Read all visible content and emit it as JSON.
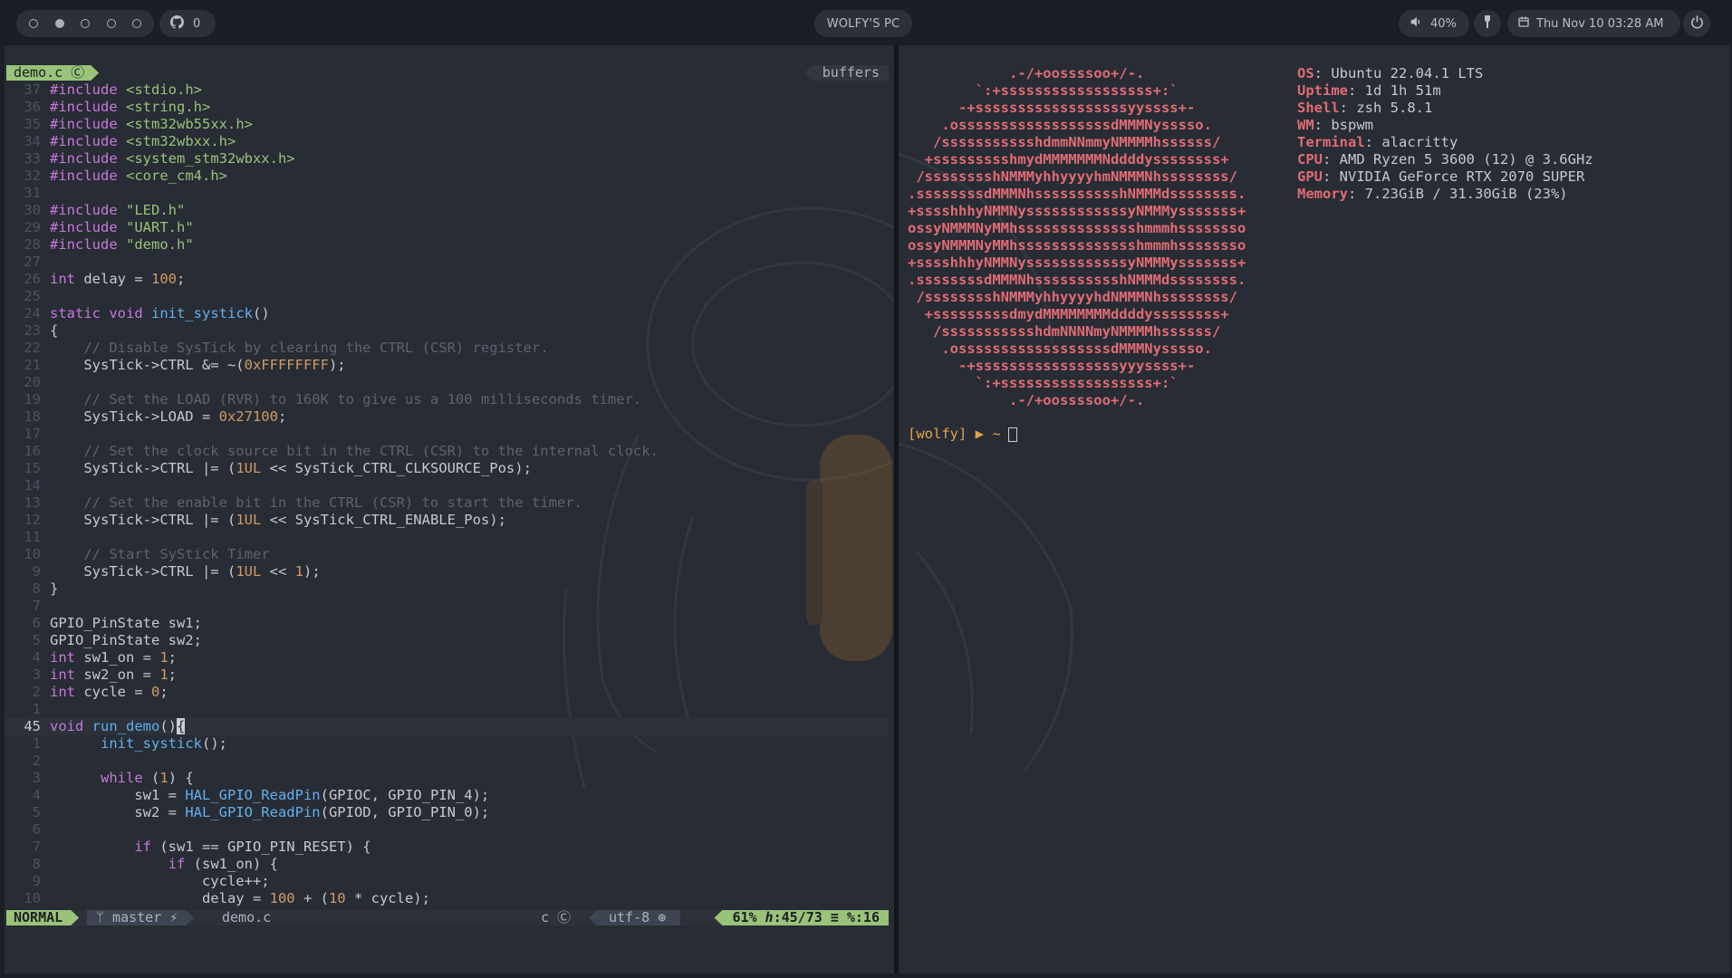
{
  "topbar": {
    "github_count": "0",
    "title": "WOLFY'S PC",
    "volume": "40%",
    "datetime": "Thu Nov 10 03:28 AM",
    "workspaces": [
      {
        "active": false
      },
      {
        "active": true
      },
      {
        "active": false
      },
      {
        "active": false
      },
      {
        "active": false
      }
    ]
  },
  "editor": {
    "tab_file": "demo.c",
    "tab_buffers": "buffers",
    "lines": [
      {
        "n": "37",
        "tokens": [
          [
            "kw",
            "#include"
          ],
          [
            "tx",
            " "
          ],
          [
            "str",
            "<stdio.h>"
          ]
        ]
      },
      {
        "n": "36",
        "tokens": [
          [
            "kw",
            "#include"
          ],
          [
            "tx",
            " "
          ],
          [
            "str",
            "<string.h>"
          ]
        ]
      },
      {
        "n": "35",
        "tokens": [
          [
            "kw",
            "#include"
          ],
          [
            "tx",
            " "
          ],
          [
            "str",
            "<stm32wb55xx.h>"
          ]
        ]
      },
      {
        "n": "34",
        "tokens": [
          [
            "kw",
            "#include"
          ],
          [
            "tx",
            " "
          ],
          [
            "str",
            "<stm32wbxx.h>"
          ]
        ]
      },
      {
        "n": "33",
        "tokens": [
          [
            "kw",
            "#include"
          ],
          [
            "tx",
            " "
          ],
          [
            "str",
            "<system_stm32wbxx.h>"
          ]
        ]
      },
      {
        "n": "32",
        "tokens": [
          [
            "kw",
            "#include"
          ],
          [
            "tx",
            " "
          ],
          [
            "str",
            "<core_cm4.h>"
          ]
        ]
      },
      {
        "n": "31",
        "tokens": []
      },
      {
        "n": "30",
        "tokens": [
          [
            "kw",
            "#include"
          ],
          [
            "tx",
            " "
          ],
          [
            "str",
            "\"LED.h\""
          ]
        ]
      },
      {
        "n": "29",
        "tokens": [
          [
            "kw",
            "#include"
          ],
          [
            "tx",
            " "
          ],
          [
            "str",
            "\"UART.h\""
          ]
        ]
      },
      {
        "n": "28",
        "tokens": [
          [
            "kw",
            "#include"
          ],
          [
            "tx",
            " "
          ],
          [
            "str",
            "\"demo.h\""
          ]
        ]
      },
      {
        "n": "27",
        "tokens": []
      },
      {
        "n": "26",
        "tokens": [
          [
            "kw",
            "int"
          ],
          [
            "tx",
            " delay = "
          ],
          [
            "num",
            "100"
          ],
          [
            "tx",
            ";"
          ]
        ]
      },
      {
        "n": "25",
        "tokens": []
      },
      {
        "n": "24",
        "tokens": [
          [
            "kw",
            "static"
          ],
          [
            "tx",
            " "
          ],
          [
            "kw",
            "void"
          ],
          [
            "tx",
            " "
          ],
          [
            "fn",
            "init_systick"
          ],
          [
            "tx",
            "()"
          ]
        ]
      },
      {
        "n": "23",
        "tokens": [
          [
            "tx",
            "{"
          ]
        ]
      },
      {
        "n": "22",
        "tokens": [
          [
            "tx",
            "    "
          ],
          [
            "cm",
            "// Disable SysTick by clearing the CTRL (CSR) register."
          ]
        ]
      },
      {
        "n": "21",
        "tokens": [
          [
            "tx",
            "    SysTick->CTRL &= ~("
          ],
          [
            "num",
            "0xFFFFFFFF"
          ],
          [
            "tx",
            ");"
          ]
        ]
      },
      {
        "n": "20",
        "tokens": []
      },
      {
        "n": "19",
        "tokens": [
          [
            "tx",
            "    "
          ],
          [
            "cm",
            "// Set the LOAD (RVR) to 160K to give us a 100 milliseconds timer."
          ]
        ]
      },
      {
        "n": "18",
        "tokens": [
          [
            "tx",
            "    SysTick->LOAD = "
          ],
          [
            "num",
            "0x27100"
          ],
          [
            "tx",
            ";"
          ]
        ]
      },
      {
        "n": "17",
        "tokens": []
      },
      {
        "n": "16",
        "tokens": [
          [
            "tx",
            "    "
          ],
          [
            "cm",
            "// Set the clock source bit in the CTRL (CSR) to the internal clock."
          ]
        ]
      },
      {
        "n": "15",
        "tokens": [
          [
            "tx",
            "    SysTick->CTRL |= ("
          ],
          [
            "num",
            "1UL"
          ],
          [
            "tx",
            " << SysTick_CTRL_CLKSOURCE_Pos);"
          ]
        ]
      },
      {
        "n": "14",
        "tokens": []
      },
      {
        "n": "13",
        "tokens": [
          [
            "tx",
            "    "
          ],
          [
            "cm",
            "// Set the enable bit in the CTRL (CSR) to start the timer."
          ]
        ]
      },
      {
        "n": "12",
        "tokens": [
          [
            "tx",
            "    SysTick->CTRL |= ("
          ],
          [
            "num",
            "1UL"
          ],
          [
            "tx",
            " << SysTick_CTRL_ENABLE_Pos);"
          ]
        ]
      },
      {
        "n": "11",
        "tokens": []
      },
      {
        "n": "10",
        "tokens": [
          [
            "tx",
            "    "
          ],
          [
            "cm",
            "// Start SyStick Timer"
          ]
        ]
      },
      {
        "n": "9",
        "tokens": [
          [
            "tx",
            "    SysTick->CTRL |= ("
          ],
          [
            "num",
            "1UL"
          ],
          [
            "tx",
            " << "
          ],
          [
            "num",
            "1"
          ],
          [
            "tx",
            ");"
          ]
        ]
      },
      {
        "n": "8",
        "tokens": [
          [
            "tx",
            "}"
          ]
        ]
      },
      {
        "n": "7",
        "tokens": []
      },
      {
        "n": "6",
        "tokens": [
          [
            "tx",
            "GPIO_PinState sw1;"
          ]
        ]
      },
      {
        "n": "5",
        "tokens": [
          [
            "tx",
            "GPIO_PinState sw2;"
          ]
        ]
      },
      {
        "n": "4",
        "tokens": [
          [
            "kw",
            "int"
          ],
          [
            "tx",
            " sw1_on = "
          ],
          [
            "num",
            "1"
          ],
          [
            "tx",
            ";"
          ]
        ]
      },
      {
        "n": "3",
        "tokens": [
          [
            "kw",
            "int"
          ],
          [
            "tx",
            " sw2_on = "
          ],
          [
            "num",
            "1"
          ],
          [
            "tx",
            ";"
          ]
        ]
      },
      {
        "n": "2",
        "tokens": [
          [
            "kw",
            "int"
          ],
          [
            "tx",
            " cycle = "
          ],
          [
            "num",
            "0"
          ],
          [
            "tx",
            ";"
          ]
        ]
      },
      {
        "n": "1",
        "tokens": []
      },
      {
        "n": "45",
        "current": true,
        "tokens": [
          [
            "kw",
            "void"
          ],
          [
            "tx",
            " "
          ],
          [
            "fn",
            "run_demo"
          ],
          [
            "tx",
            "()"
          ],
          [
            "cur",
            "{"
          ]
        ]
      },
      {
        "n": "1",
        "tokens": [
          [
            "tx",
            "      "
          ],
          [
            "fn",
            "init_systick"
          ],
          [
            "tx",
            "();"
          ]
        ]
      },
      {
        "n": "2",
        "tokens": []
      },
      {
        "n": "3",
        "tokens": [
          [
            "tx",
            "      "
          ],
          [
            "kw",
            "while"
          ],
          [
            "tx",
            " ("
          ],
          [
            "num",
            "1"
          ],
          [
            "tx",
            ") {"
          ]
        ]
      },
      {
        "n": "4",
        "tokens": [
          [
            "tx",
            "          sw1 = "
          ],
          [
            "fn",
            "HAL_GPIO_ReadPin"
          ],
          [
            "tx",
            "(GPIOC, GPIO_PIN_4);"
          ]
        ]
      },
      {
        "n": "5",
        "tokens": [
          [
            "tx",
            "          sw2 = "
          ],
          [
            "fn",
            "HAL_GPIO_ReadPin"
          ],
          [
            "tx",
            "(GPIOD, GPIO_PIN_0);"
          ]
        ]
      },
      {
        "n": "6",
        "tokens": []
      },
      {
        "n": "7",
        "tokens": [
          [
            "tx",
            "          "
          ],
          [
            "kw",
            "if"
          ],
          [
            "tx",
            " (sw1 == GPIO_PIN_RESET) {"
          ]
        ]
      },
      {
        "n": "8",
        "tokens": [
          [
            "tx",
            "              "
          ],
          [
            "kw",
            "if"
          ],
          [
            "tx",
            " (sw1_on) {"
          ]
        ]
      },
      {
        "n": "9",
        "tokens": [
          [
            "tx",
            "                  cycle++;"
          ]
        ]
      },
      {
        "n": "10",
        "tokens": [
          [
            "tx",
            "                  delay = "
          ],
          [
            "num",
            "100"
          ],
          [
            "tx",
            " + ("
          ],
          [
            "num",
            "10"
          ],
          [
            "tx",
            " * cycle);"
          ]
        ]
      }
    ],
    "status": {
      "mode": "NORMAL",
      "branch": "master",
      "file": "demo.c",
      "filetype": "c",
      "encoding": "utf-8",
      "position": "61% ℎ:45/73 ≡ %:16"
    }
  },
  "terminal": {
    "ascii": [
      "            .-/+oossssoo+/-.",
      "        `:+ssssssssssssssssss+:`",
      "      -+ssssssssssssssssssyyssss+-",
      "    .ossssssssssssssssssdMMMNysssso.",
      "   /ssssssssssshdmmNNmmyNMMMMhssssss/",
      "  +ssssssssshmydMMMMMMMNddddyssssssss+",
      " /sssssssshNMMMyhhyyyyhmNMMMNhssssssss/",
      ".ssssssssdMMMNhsssssssssshNMMMdssssssss.",
      "+sssshhhyNMMNyssssssssssssyNMMMysssssss+",
      "ossyNMMMNyMMhsssssssssssssshmmmhssssssso",
      "ossyNMMMNyMMhsssssssssssssshmmmhssssssso",
      "+sssshhhyNMMNyssssssssssssyNMMMysssssss+",
      ".ssssssssdMMMNhsssssssssshNMMMdssssssss.",
      " /sssssssshNMMMyhhyyyyhdNMMMNhssssssss/",
      "  +sssssssssdmydMMMMMMMMddddyssssssss+",
      "   /ssssssssssshdmNNNNmyNMMMMhssssss/",
      "    .ossssssssssssssssssdMMMNysssso.",
      "      -+sssssssssssssssssyyyssss+-",
      "        `:+ssssssssssssssssss+:`",
      "            .-/+oossssoo+/-."
    ],
    "info": [
      {
        "key": "OS",
        "value": "Ubuntu 22.04.1 LTS"
      },
      {
        "key": "Uptime",
        "value": "1d 1h 51m"
      },
      {
        "key": "Shell",
        "value": "zsh 5.8.1"
      },
      {
        "key": "WM",
        "value": "bspwm"
      },
      {
        "key": "Terminal",
        "value": "alacritty"
      },
      {
        "key": "CPU",
        "value": "AMD Ryzen 5 3600 (12) @ 3.6GHz"
      },
      {
        "key": "GPU",
        "value": "NVIDIA GeForce RTX 2070 SUPER"
      },
      {
        "key": "Memory",
        "value": "7.23GiB / 31.30GiB (23%)"
      }
    ],
    "prompt": "[wolfy] ▶ ~"
  }
}
